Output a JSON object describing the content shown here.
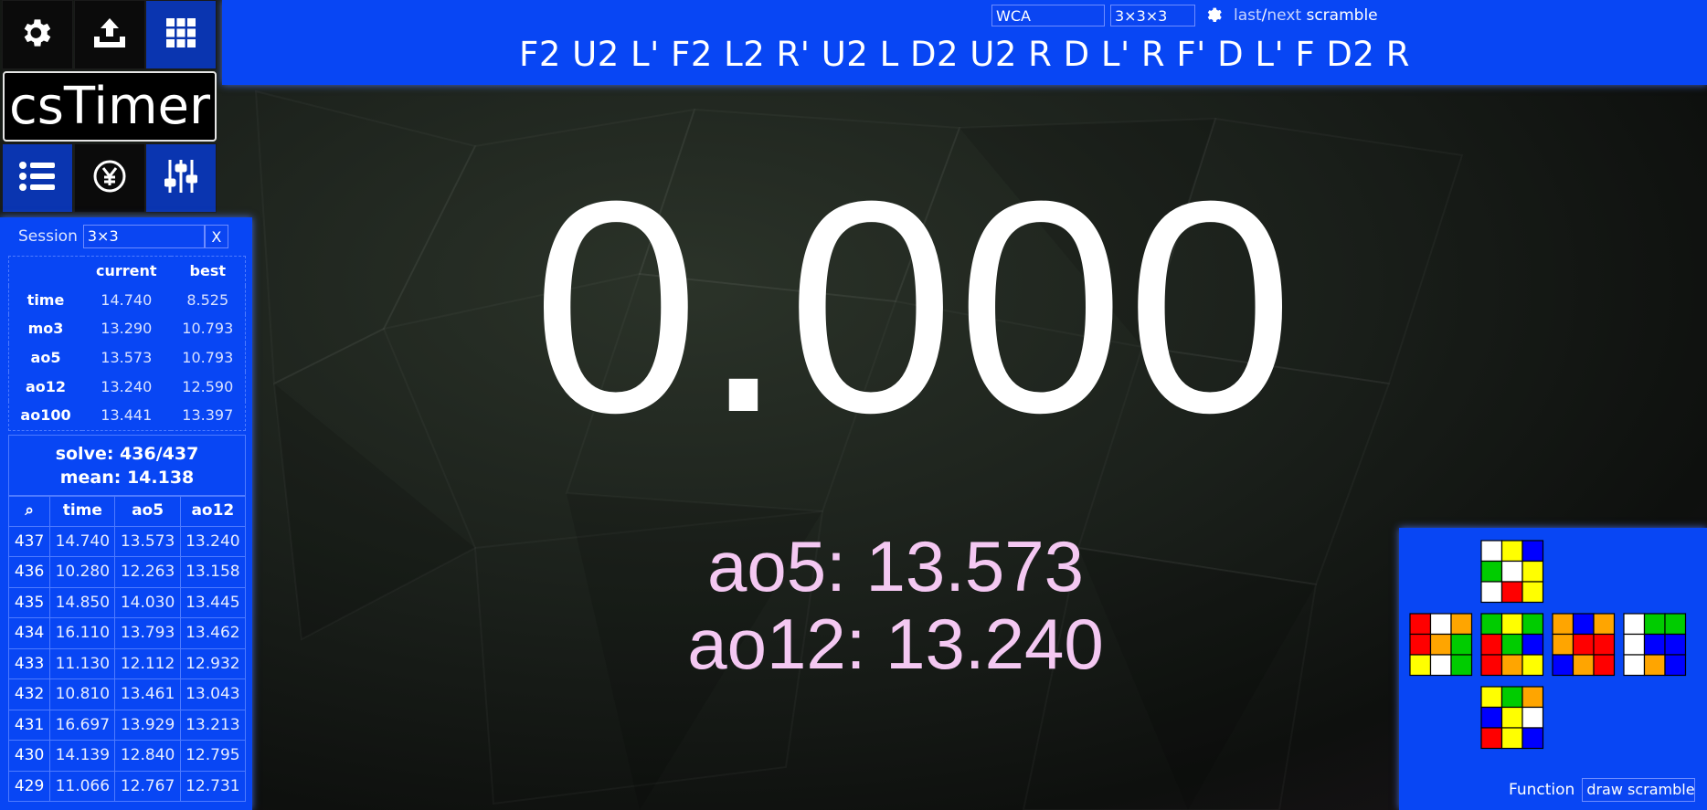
{
  "colors": {
    "panel_blue": "#0846f4",
    "avg_text": "#f4c8f2",
    "cube": {
      "W": "#ffffff",
      "Y": "#ffff00",
      "R": "#ff0000",
      "O": "#ffa500",
      "G": "#00cc00",
      "B": "#0000ff"
    }
  },
  "icons": {
    "menu": [
      "gear-icon",
      "export-icon",
      "grid-icon",
      "list-icon",
      "donate-yen-icon",
      "sliders-icon"
    ],
    "scramble_settings": "gear-icon"
  },
  "header": {
    "scramble_type": "WCA",
    "puzzle": "3×3×3",
    "last_label": "last",
    "slash": "/",
    "next_label": "next",
    "scramble_word": " scramble",
    "scramble": "F2 U2 L' F2 L2 R' U2 L D2 U2 R D L' R F' D L' F D2 R"
  },
  "logo": "csTimer",
  "session": {
    "label": "Session",
    "name": "3×3",
    "close": "X"
  },
  "stats": {
    "headers": [
      "",
      "current",
      "best"
    ],
    "rows": [
      {
        "label": "time",
        "current": "14.740",
        "best": "8.525"
      },
      {
        "label": "mo3",
        "current": "13.290",
        "best": "10.793"
      },
      {
        "label": "ao5",
        "current": "13.573",
        "best": "10.793"
      },
      {
        "label": "ao12",
        "current": "13.240",
        "best": "12.590"
      },
      {
        "label": "ao100",
        "current": "13.441",
        "best": "13.397"
      }
    ]
  },
  "summary": {
    "solve": "solve: 436/437",
    "mean": "mean: 14.138"
  },
  "times": {
    "headers": [
      "⌕",
      "time",
      "ao5",
      "ao12"
    ],
    "rows": [
      [
        "437",
        "14.740",
        "13.573",
        "13.240"
      ],
      [
        "436",
        "10.280",
        "12.263",
        "13.158"
      ],
      [
        "435",
        "14.850",
        "14.030",
        "13.445"
      ],
      [
        "434",
        "16.110",
        "13.793",
        "13.462"
      ],
      [
        "433",
        "11.130",
        "12.112",
        "12.932"
      ],
      [
        "432",
        "10.810",
        "13.461",
        "13.043"
      ],
      [
        "431",
        "16.697",
        "13.929",
        "13.213"
      ],
      [
        "430",
        "14.139",
        "12.840",
        "12.795"
      ],
      [
        "429",
        "11.066",
        "12.767",
        "12.731"
      ]
    ]
  },
  "timer": {
    "display": "0.000",
    "ao5": "ao5: 13.573",
    "ao12": "ao12: 13.240"
  },
  "tools": {
    "function_label": "Function",
    "function_value": "draw scramble",
    "cube_net": {
      "U": [
        "W",
        "Y",
        "B",
        "G",
        "W",
        "Y",
        "W",
        "R",
        "Y"
      ],
      "L": [
        "R",
        "W",
        "O",
        "R",
        "O",
        "G",
        "Y",
        "W",
        "G"
      ],
      "F": [
        "G",
        "Y",
        "G",
        "R",
        "G",
        "B",
        "R",
        "O",
        "Y"
      ],
      "R": [
        "O",
        "B",
        "O",
        "O",
        "R",
        "R",
        "B",
        "O",
        "R"
      ],
      "B": [
        "W",
        "G",
        "G",
        "W",
        "B",
        "B",
        "W",
        "O",
        "B"
      ],
      "D": [
        "Y",
        "G",
        "O",
        "B",
        "Y",
        "W",
        "R",
        "Y",
        "B"
      ]
    }
  }
}
